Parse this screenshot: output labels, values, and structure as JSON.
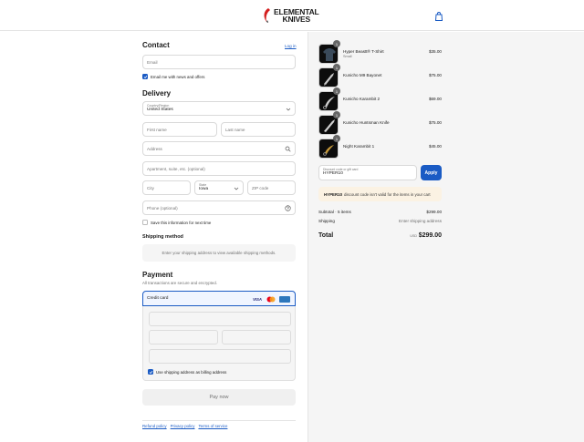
{
  "brand": {
    "line1": "ELEMENTAL",
    "line2": "KNIVES",
    "accent": "#d41f1f"
  },
  "header": {
    "cart_icon": "shopping-bag-icon"
  },
  "contact": {
    "title": "Contact",
    "login_link": "Log in",
    "email_placeholder": "Email",
    "newsletter_label": "Email me with news and offers",
    "newsletter_checked": true
  },
  "delivery": {
    "title": "Delivery",
    "country_label": "Country/Region",
    "country_value": "United States",
    "first_name_placeholder": "First name",
    "last_name_placeholder": "Last name",
    "address_placeholder": "Address",
    "apartment_placeholder": "Apartment, suite, etc. (optional)",
    "city_placeholder": "City",
    "state_label": "State",
    "state_value": "Iowa",
    "zip_placeholder": "ZIP code",
    "phone_placeholder": "Phone (optional)",
    "save_label": "Save this information for next time",
    "save_checked": false
  },
  "shipping_method": {
    "title": "Shipping method",
    "notice": "Enter your shipping address to view available shipping methods."
  },
  "payment": {
    "title": "Payment",
    "subtitle": "All transactions are secure and encrypted.",
    "method_label": "Credit card",
    "card_brand_visa": "VISA",
    "billing_label": "Use shipping address as billing address",
    "billing_checked": true,
    "pay_button": "Pay now"
  },
  "footer": {
    "links": [
      "Refund policy",
      "Privacy policy",
      "Terms of service"
    ]
  },
  "order": {
    "items": [
      {
        "name": "Hyper Beastt® T-Shirt",
        "variant": "Small",
        "qty": "1",
        "price": "$35.00"
      },
      {
        "name": "Kunicho M9 Bayonet",
        "variant": "",
        "qty": "1",
        "price": "$75.00"
      },
      {
        "name": "Kunicho Karambit 2",
        "variant": "",
        "qty": "1",
        "price": "$69.00"
      },
      {
        "name": "Kunicho Huntsman Knife",
        "variant": "",
        "qty": "1",
        "price": "$75.00"
      },
      {
        "name": "Night Karambit 1",
        "variant": "",
        "qty": "1",
        "price": "$45.00"
      }
    ],
    "discount_label": "Discount code or gift card",
    "discount_value": "HYPER10",
    "apply_button": "Apply",
    "warning_code": "HYPER10",
    "warning_text": "discount code isn't valid for the items in your cart",
    "subtotal_label": "Subtotal · 5 items",
    "subtotal_value": "$299.00",
    "shipping_label": "Shipping",
    "shipping_value": "Enter shipping address",
    "total_label": "Total",
    "currency": "USD",
    "total_value": "$299.00"
  },
  "colors": {
    "primary": "#1a5bc4",
    "warning_bg": "#fbf2e3",
    "summary_bg": "#f5f5f5"
  }
}
